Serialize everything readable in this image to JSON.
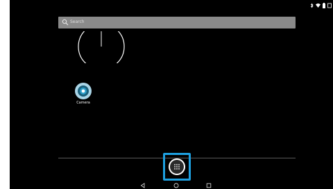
{
  "screen": {
    "background": "#000000",
    "accent": "#1ea0e0"
  },
  "status_bar": {
    "icons": [
      "bluetooth-icon",
      "wifi-icon",
      "battery-icon",
      "clock-icon"
    ]
  },
  "search": {
    "placeholder": "Search",
    "icon": "search-icon"
  },
  "clock_widget": {
    "type": "analog"
  },
  "apps": [
    {
      "label": "Camera",
      "icon": "camera-icon"
    }
  ],
  "dock": {
    "all_apps_icon": "all-apps-icon",
    "highlighted": true
  },
  "navigation": {
    "buttons": [
      "back-icon",
      "home-icon",
      "recents-icon"
    ]
  }
}
